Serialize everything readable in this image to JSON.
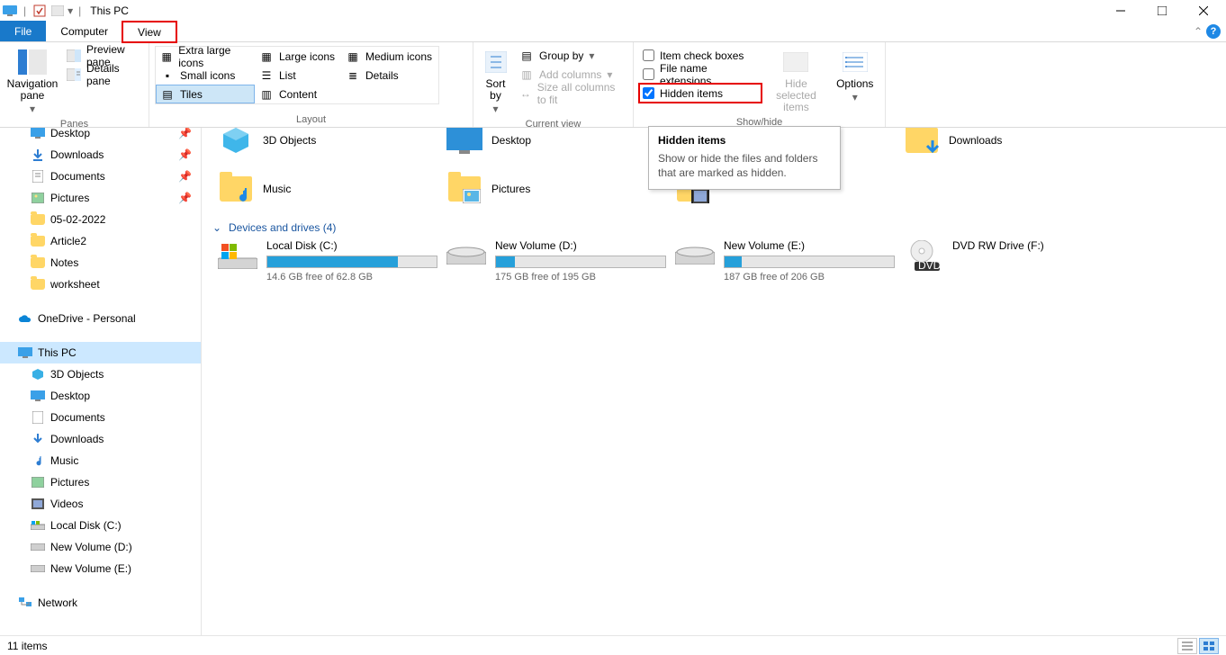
{
  "title": "This PC",
  "tabs": {
    "file": "File",
    "computer": "Computer",
    "view": "View"
  },
  "ribbon": {
    "panes": {
      "group": "Panes",
      "nav": "Navigation pane",
      "preview": "Preview pane",
      "details": "Details pane"
    },
    "layout": {
      "group": "Layout",
      "xl": "Extra large icons",
      "l": "Large icons",
      "m": "Medium icons",
      "s": "Small icons",
      "list": "List",
      "details": "Details",
      "tiles": "Tiles",
      "content": "Content"
    },
    "current_view": {
      "group": "Current view",
      "sort": "Sort by",
      "group_by": "Group by",
      "add_cols": "Add columns",
      "size_cols": "Size all columns to fit"
    },
    "showhide": {
      "group": "Show/hide",
      "check": "Item check boxes",
      "ext": "File name extensions",
      "hidden": "Hidden items",
      "hide_sel": "Hide selected items",
      "options": "Options"
    }
  },
  "tooltip": {
    "title": "Hidden items",
    "body": "Show or hide the files and folders that are marked as hidden."
  },
  "nav": {
    "desktop": "Desktop",
    "downloads": "Downloads",
    "documents": "Documents",
    "pictures": "Pictures",
    "f1": "05-02-2022",
    "f2": "Article2",
    "f3": "Notes",
    "f4": "worksheet",
    "onedrive": "OneDrive - Personal",
    "thispc": "This PC",
    "obj3d": "3D Objects",
    "desktop2": "Desktop",
    "documents2": "Documents",
    "downloads2": "Downloads",
    "music": "Music",
    "pictures2": "Pictures",
    "videos": "Videos",
    "ldc": "Local Disk (C:)",
    "nvd": "New Volume (D:)",
    "nve": "New Volume (E:)",
    "network": "Network"
  },
  "folders": {
    "obj3d": "3D Objects",
    "desktop": "Desktop",
    "downloads": "Downloads",
    "music": "Music",
    "pictures": "Pictures"
  },
  "section": "Devices and drives (4)",
  "drives": {
    "c": {
      "name": "Local Disk (C:)",
      "free": "14.6 GB free of 62.8 GB",
      "pct": 77
    },
    "d": {
      "name": "New Volume (D:)",
      "free": "175 GB free of 195 GB",
      "pct": 11
    },
    "e": {
      "name": "New Volume (E:)",
      "free": "187 GB free of 206 GB",
      "pct": 10
    },
    "f": {
      "name": "DVD RW Drive (F:)"
    }
  },
  "status": "11 items"
}
